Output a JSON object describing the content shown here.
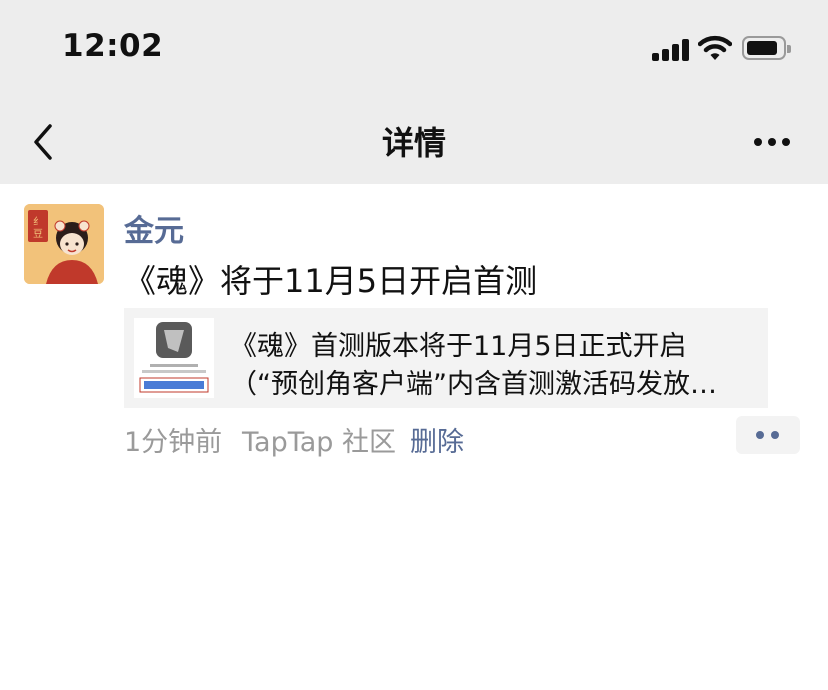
{
  "status_bar": {
    "time": "12:02"
  },
  "nav": {
    "title": "详情"
  },
  "post": {
    "username": "金元",
    "text": "《魂》将于11月5日开启首测",
    "link_card": {
      "line1": "《魂》首测版本将于11月5日正式开启",
      "line2": "（“预创角客户端”内含首测激活码发放…"
    },
    "time_ago": "1分钟前",
    "source": "TapTap 社区",
    "delete_label": "删除"
  },
  "colors": {
    "link_blue": "#576b95",
    "nav_bg": "#ededed",
    "card_bg": "#f3f3f3",
    "meta_gray": "#9a9a9a"
  },
  "icons": [
    "cellular-signal-icon",
    "wifi-icon",
    "battery-icon",
    "back-chevron-icon",
    "more-dots-icon",
    "comment-dots-icon"
  ]
}
